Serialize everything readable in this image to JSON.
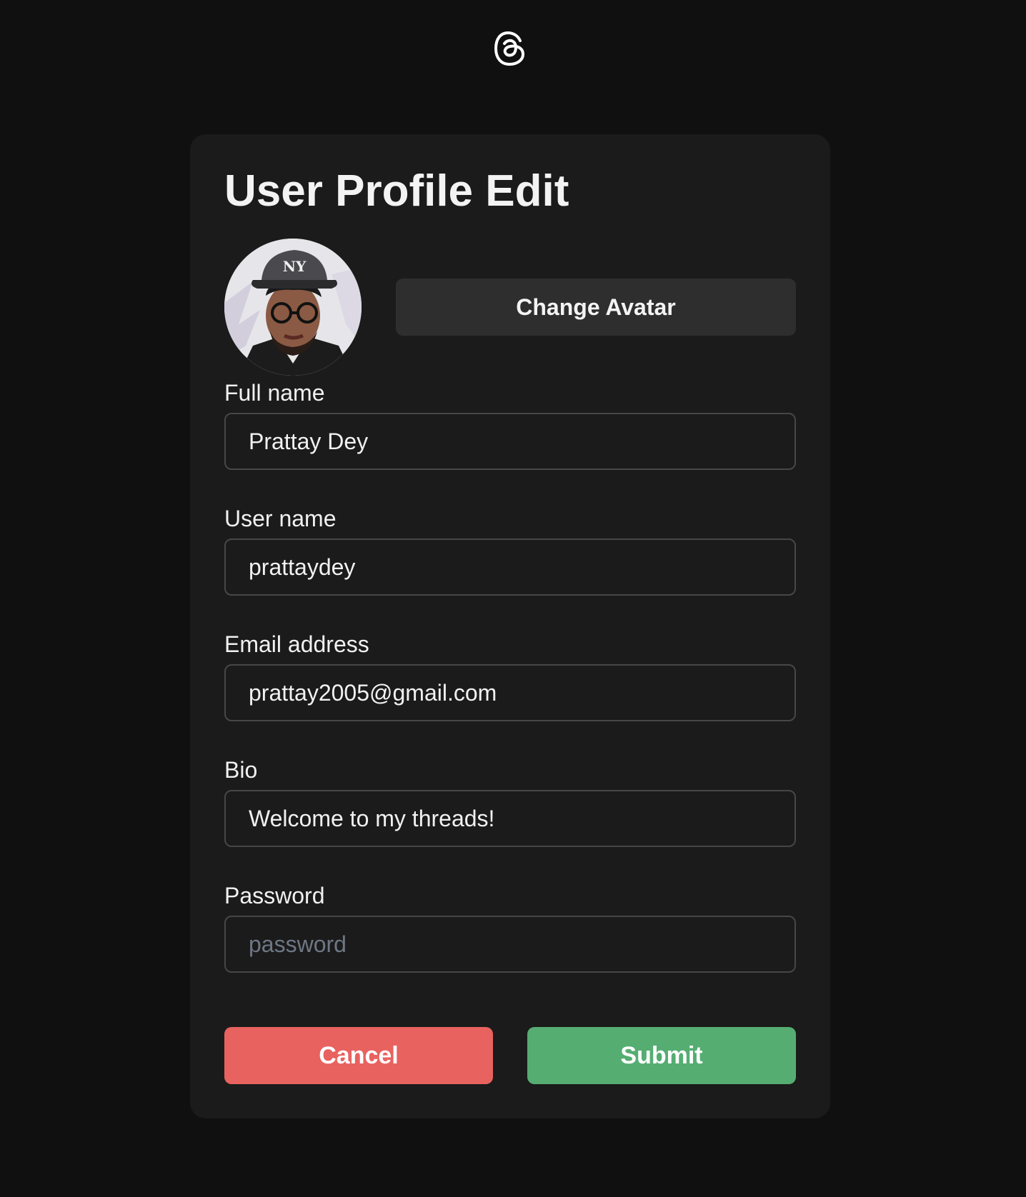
{
  "brand": {
    "logo_icon": "threads-logo-icon"
  },
  "form": {
    "title": "User Profile Edit",
    "avatar_alt": "User avatar",
    "change_avatar_label": "Change Avatar",
    "fields": {
      "full_name": {
        "label": "Full name",
        "value": "Prattay Dey",
        "placeholder": ""
      },
      "user_name": {
        "label": "User name",
        "value": "prattaydey",
        "placeholder": ""
      },
      "email": {
        "label": "Email address",
        "value": "prattay2005@gmail.com",
        "placeholder": ""
      },
      "bio": {
        "label": "Bio",
        "value": "Welcome to my threads!",
        "placeholder": ""
      },
      "password": {
        "label": "Password",
        "value": "",
        "placeholder": "password"
      }
    },
    "cancel_label": "Cancel",
    "submit_label": "Submit"
  },
  "colors": {
    "page_bg": "#101010",
    "card_bg": "#1b1b1b",
    "secondary_button": "#2e2e2e",
    "cancel": "#e8625f",
    "submit": "#55ad72",
    "input_border": "#474747"
  }
}
